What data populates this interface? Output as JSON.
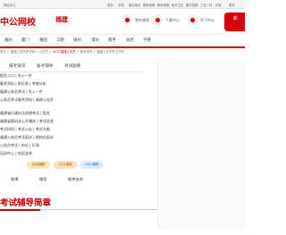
{
  "topbar": {
    "left_text": "网站中心",
    "links": [
      "首页",
      "本校",
      "事业单位",
      "教师招聘",
      "教师资格",
      "医疗卫生",
      "银行招聘",
      "三支一扶",
      "村官",
      "更多"
    ]
  },
  "header": {
    "brand": "中公网校",
    "region": "福建",
    "my_courses": "我的课程",
    "download_center": "下载中心",
    "learning_center": "学习中心",
    "badge_text": "新"
  },
  "nav": {
    "items": [
      "福州",
      "厦门",
      "莆田",
      "三明",
      "泉州",
      "漳州",
      "南平",
      "龙岩",
      "宁德"
    ]
  },
  "breadcrumb": {
    "items": [
      "首页",
      "福建公务员考试网",
      "公务员",
      "2022福建公务员",
      "备考指导",
      "福建公务员考试冲刺"
    ]
  },
  "tabs": [
    "报考资讯",
    "备考辅导",
    "考试题库"
  ],
  "content": {
    "lines": [
      "报名入口 | 先入一步",
      "备考资料 | 职位表 | 考情分析",
      "福建公务员考试 | 先入一步",
      "公务员考试备考资料 | 福建公务员",
      "福建省行政执法资格考试 | 报名",
      "福建省直机关公开遴选 | 考试信息",
      "考试时间 | 考试公告 | 考试大纲",
      "福建公务员考试面试 | 结构化面试",
      "公务员考试 | 申论 | 行测",
      "培训中心 | 电话咨询"
    ]
  },
  "pills": [
    {
      "label": "协议课程",
      "bg": "#f6e6b8",
      "fg": "#7a5b00"
    },
    {
      "label": "1对1课程",
      "bg": "#fbe0c6",
      "fg": "#b25a00"
    },
    {
      "label": "OAO课程",
      "bg": "#dcecff",
      "fg": "#2d6fc0"
    }
  ],
  "quick_links": [
    "微博",
    "微信",
    "报考咨询"
  ],
  "section": {
    "title": "考试辅导简章"
  },
  "colors": {
    "brand": "#c8000a",
    "accent": "#d8020b"
  }
}
